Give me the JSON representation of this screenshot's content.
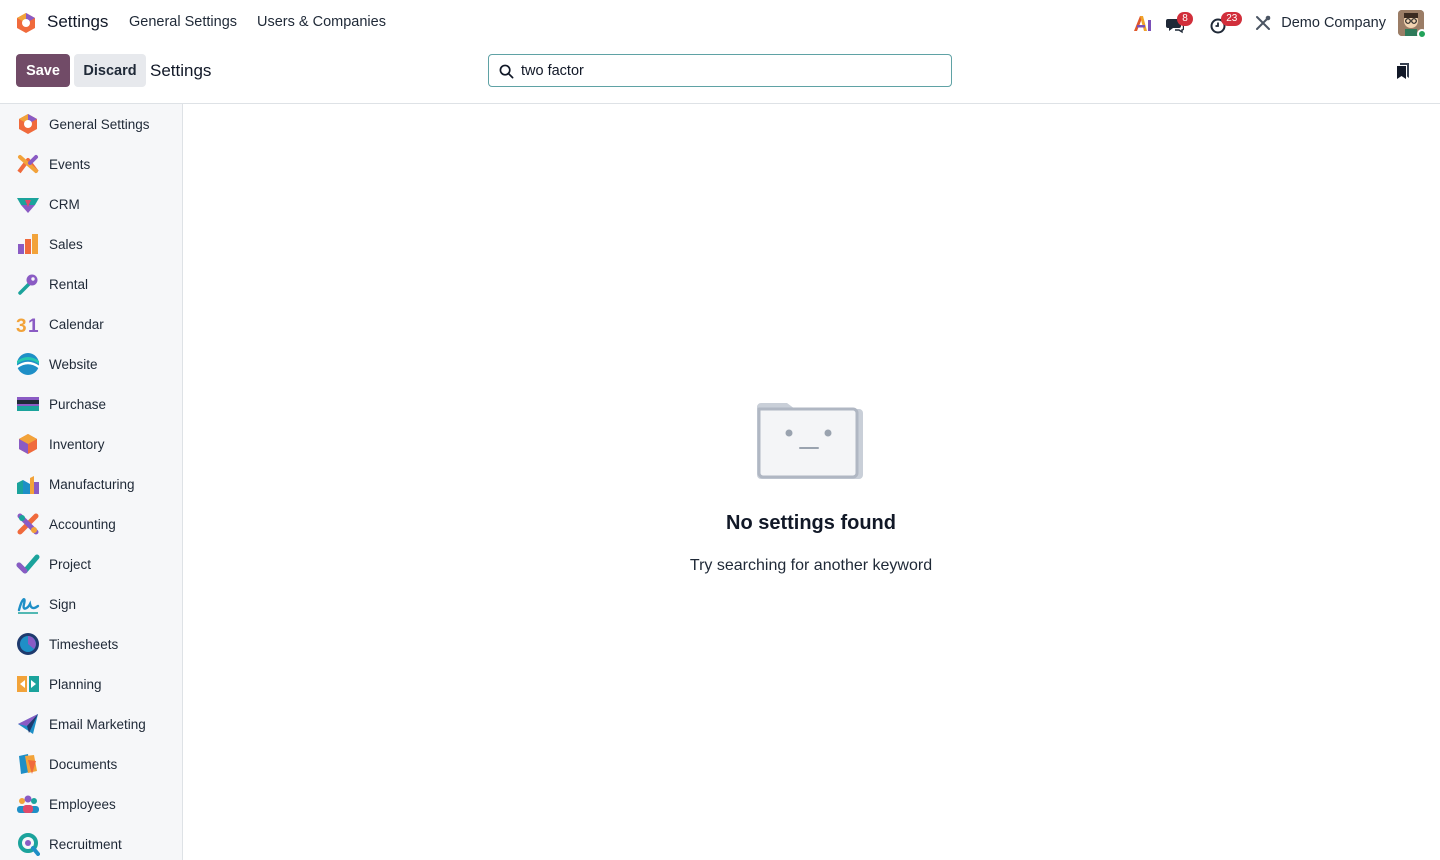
{
  "navbar": {
    "app_name": "Settings",
    "menu": [
      "General Settings",
      "Users & Companies"
    ],
    "messages_badge": "8",
    "activities_badge": "23",
    "company": "Demo Company"
  },
  "control_panel": {
    "save_label": "Save",
    "discard_label": "Discard",
    "title": "Settings",
    "search_value": "two factor"
  },
  "sidebar": {
    "items": [
      {
        "label": "General Settings",
        "icon": "general-settings-icon"
      },
      {
        "label": "Events",
        "icon": "events-icon"
      },
      {
        "label": "CRM",
        "icon": "crm-icon"
      },
      {
        "label": "Sales",
        "icon": "sales-icon"
      },
      {
        "label": "Rental",
        "icon": "rental-icon"
      },
      {
        "label": "Calendar",
        "icon": "calendar-icon"
      },
      {
        "label": "Website",
        "icon": "website-icon"
      },
      {
        "label": "Purchase",
        "icon": "purchase-icon"
      },
      {
        "label": "Inventory",
        "icon": "inventory-icon"
      },
      {
        "label": "Manufacturing",
        "icon": "manufacturing-icon"
      },
      {
        "label": "Accounting",
        "icon": "accounting-icon"
      },
      {
        "label": "Project",
        "icon": "project-icon"
      },
      {
        "label": "Sign",
        "icon": "sign-icon"
      },
      {
        "label": "Timesheets",
        "icon": "timesheets-icon"
      },
      {
        "label": "Planning",
        "icon": "planning-icon"
      },
      {
        "label": "Email Marketing",
        "icon": "email-marketing-icon"
      },
      {
        "label": "Documents",
        "icon": "documents-icon"
      },
      {
        "label": "Employees",
        "icon": "employees-icon"
      },
      {
        "label": "Recruitment",
        "icon": "recruitment-icon"
      }
    ]
  },
  "empty_state": {
    "title": "No settings found",
    "subtitle": "Try searching for another keyword"
  },
  "colors": {
    "brand": "#714b67",
    "badge": "#d12f3b",
    "search_border": "#5fa2a5",
    "online": "#22a35a"
  }
}
